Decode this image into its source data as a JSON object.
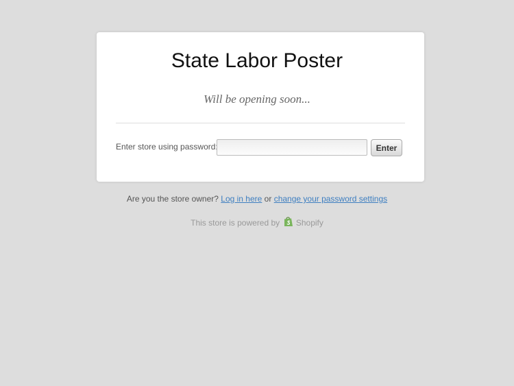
{
  "store": {
    "title": "State Labor Poster",
    "tagline": "Will be opening soon..."
  },
  "password_form": {
    "label": "Enter store using password:",
    "input_value": "",
    "submit_label": "Enter"
  },
  "footer": {
    "owner_prompt": "Are you the store owner?",
    "login_link": "Log in here",
    "connector": "or",
    "settings_link": "change your password settings",
    "powered_by": "This store is powered by",
    "platform_name": "Shopify",
    "platform_icon": "shopify-bag-icon"
  },
  "colors": {
    "background": "#dddddd",
    "card": "#ffffff",
    "link": "#3d7ec0",
    "shopify_green": "#7ab55c"
  }
}
